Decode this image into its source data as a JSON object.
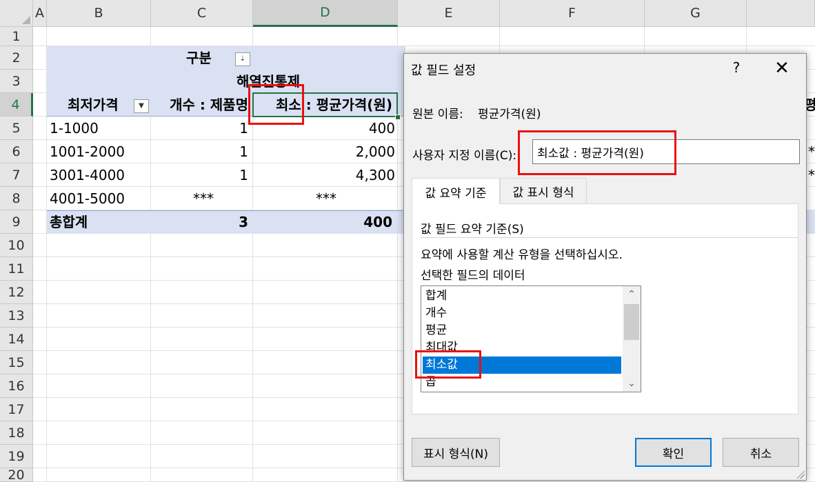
{
  "sheet": {
    "columns": [
      "A",
      "B",
      "C",
      "D",
      "E",
      "F",
      "G"
    ],
    "rows": [
      "1",
      "2",
      "3",
      "4",
      "5",
      "6",
      "7",
      "8",
      "9",
      "10",
      "11",
      "12",
      "13",
      "14",
      "15",
      "16",
      "17",
      "18",
      "19",
      "20"
    ],
    "pivot": {
      "category_label": "구분",
      "sort_icon": "sort-filter-icon",
      "sub_header": "해열진통제",
      "col_headers": {
        "b": "최저가격",
        "c": "개수 : 제품명",
        "d": "최소 : 평균가격(원)"
      },
      "rows": [
        {
          "range": "1-1000",
          "count": "1",
          "min": "400"
        },
        {
          "range": "1001-2000",
          "count": "1",
          "min": "2,000"
        },
        {
          "range": "3001-4000",
          "count": "1",
          "min": "4,300"
        },
        {
          "range": "4001-5000",
          "count": "***",
          "min": "***"
        }
      ],
      "total": {
        "label": "총합계",
        "count": "3",
        "min": "400"
      },
      "edge_text": {
        "h4": "평",
        "h6": "*",
        "h7": "*"
      }
    }
  },
  "dialog": {
    "title": "값 필드 설정",
    "help": "?",
    "close": "✕",
    "source_name_label": "원본 이름:",
    "source_name_value": "평균가격(원)",
    "custom_name_label": "사용자 지정 이름(C):",
    "custom_name_value": "최소값 : 평균가격(원)",
    "tabs": [
      "값 요약 기준",
      "값 표시 형식"
    ],
    "summarize_label": "값 필드 요약 기준(S)",
    "instruction_line1": "요약에 사용할 계산 유형을 선택하십시오.",
    "instruction_line2": "선택한 필드의 데이터",
    "list_items": [
      "합계",
      "개수",
      "평균",
      "최대값",
      "최소값",
      "곱"
    ],
    "selected_item": "최소값",
    "number_format_button": "표시 형식(N)",
    "ok_button": "확인",
    "cancel_button": "취소"
  }
}
